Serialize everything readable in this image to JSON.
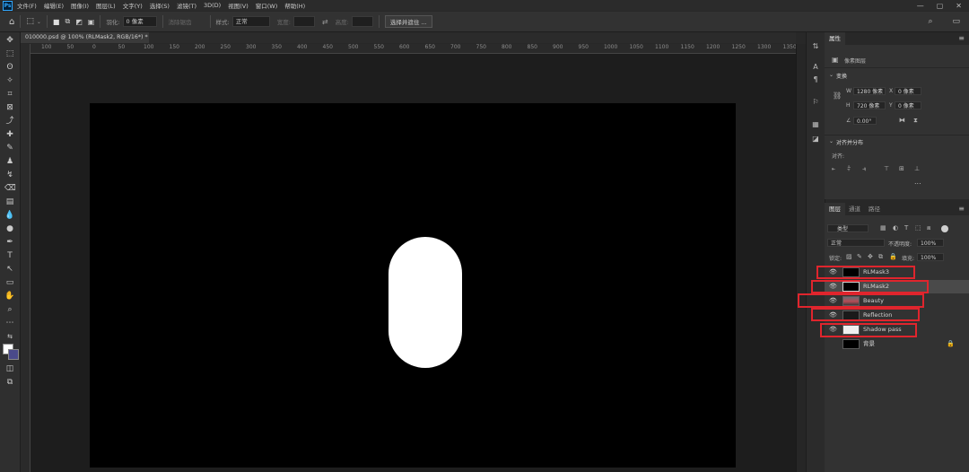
{
  "menu": {
    "app_logo": "Ps",
    "items": [
      "文件(F)",
      "编辑(E)",
      "图像(I)",
      "图层(L)",
      "文字(Y)",
      "选择(S)",
      "滤镜(T)",
      "3D(D)",
      "视图(V)",
      "窗口(W)",
      "帮助(H)"
    ],
    "window_controls": [
      "—",
      "▢",
      "✕"
    ],
    "right_icons": [
      "search-icon",
      "workspace-icon"
    ]
  },
  "options": {
    "feather_label": "羽化:",
    "feather_value": "0 像素",
    "antialias": "消除锯齿",
    "style_label": "样式:",
    "style_value": "正常",
    "width_label": "宽度:",
    "height_label": "高度:",
    "select_mask_button": "选择并遮住 ..."
  },
  "document": {
    "tab_title": "010000.psd @ 100% (RLMask2, RGB/16*) *",
    "close_glyph": "×"
  },
  "ruler": {
    "labels": [
      "100",
      "50",
      "0",
      "50",
      "100",
      "150",
      "200",
      "250",
      "300",
      "350",
      "400",
      "450",
      "500",
      "550",
      "600",
      "650",
      "700",
      "750",
      "800",
      "850",
      "900",
      "950",
      "1000",
      "1050",
      "1100",
      "1150",
      "1200",
      "1250",
      "1300",
      "1350"
    ]
  },
  "properties": {
    "tab": "属性",
    "section_pixel_layer": "像素图层",
    "transform_title": "变换",
    "w_label": "W",
    "w_value": "1280 像素",
    "x_label": "X",
    "x_value": "0 像素",
    "h_label": "H",
    "h_value": "720 像素",
    "y_label": "Y",
    "y_value": "0 像素",
    "angle_value": "0.00°",
    "align_title": "对齐并分布",
    "align_label": "对齐:",
    "more": "..."
  },
  "layers": {
    "tabs": [
      "图层",
      "通道",
      "路径"
    ],
    "filter_kind": "类型",
    "blend_mode": "正常",
    "opacity_label": "不透明度:",
    "opacity_value": "100%",
    "lock_label": "锁定:",
    "fill_label": "填充:",
    "fill_value": "100%",
    "items": [
      {
        "name": "RLMask3",
        "visible": "true",
        "selected": "false"
      },
      {
        "name": "RLMask2",
        "visible": "true",
        "selected": "true"
      },
      {
        "name": "Beauty",
        "visible": "true",
        "selected": "false"
      },
      {
        "name": "Reflection",
        "visible": "true",
        "selected": "false"
      },
      {
        "name": "Shadow pass",
        "visible": "true",
        "selected": "false"
      },
      {
        "name": "背景",
        "visible": "false",
        "selected": "false"
      }
    ]
  },
  "colors": {
    "annotation_red": "#e0252d",
    "foreground": "#ffffff",
    "background": "#4a4a8a"
  }
}
